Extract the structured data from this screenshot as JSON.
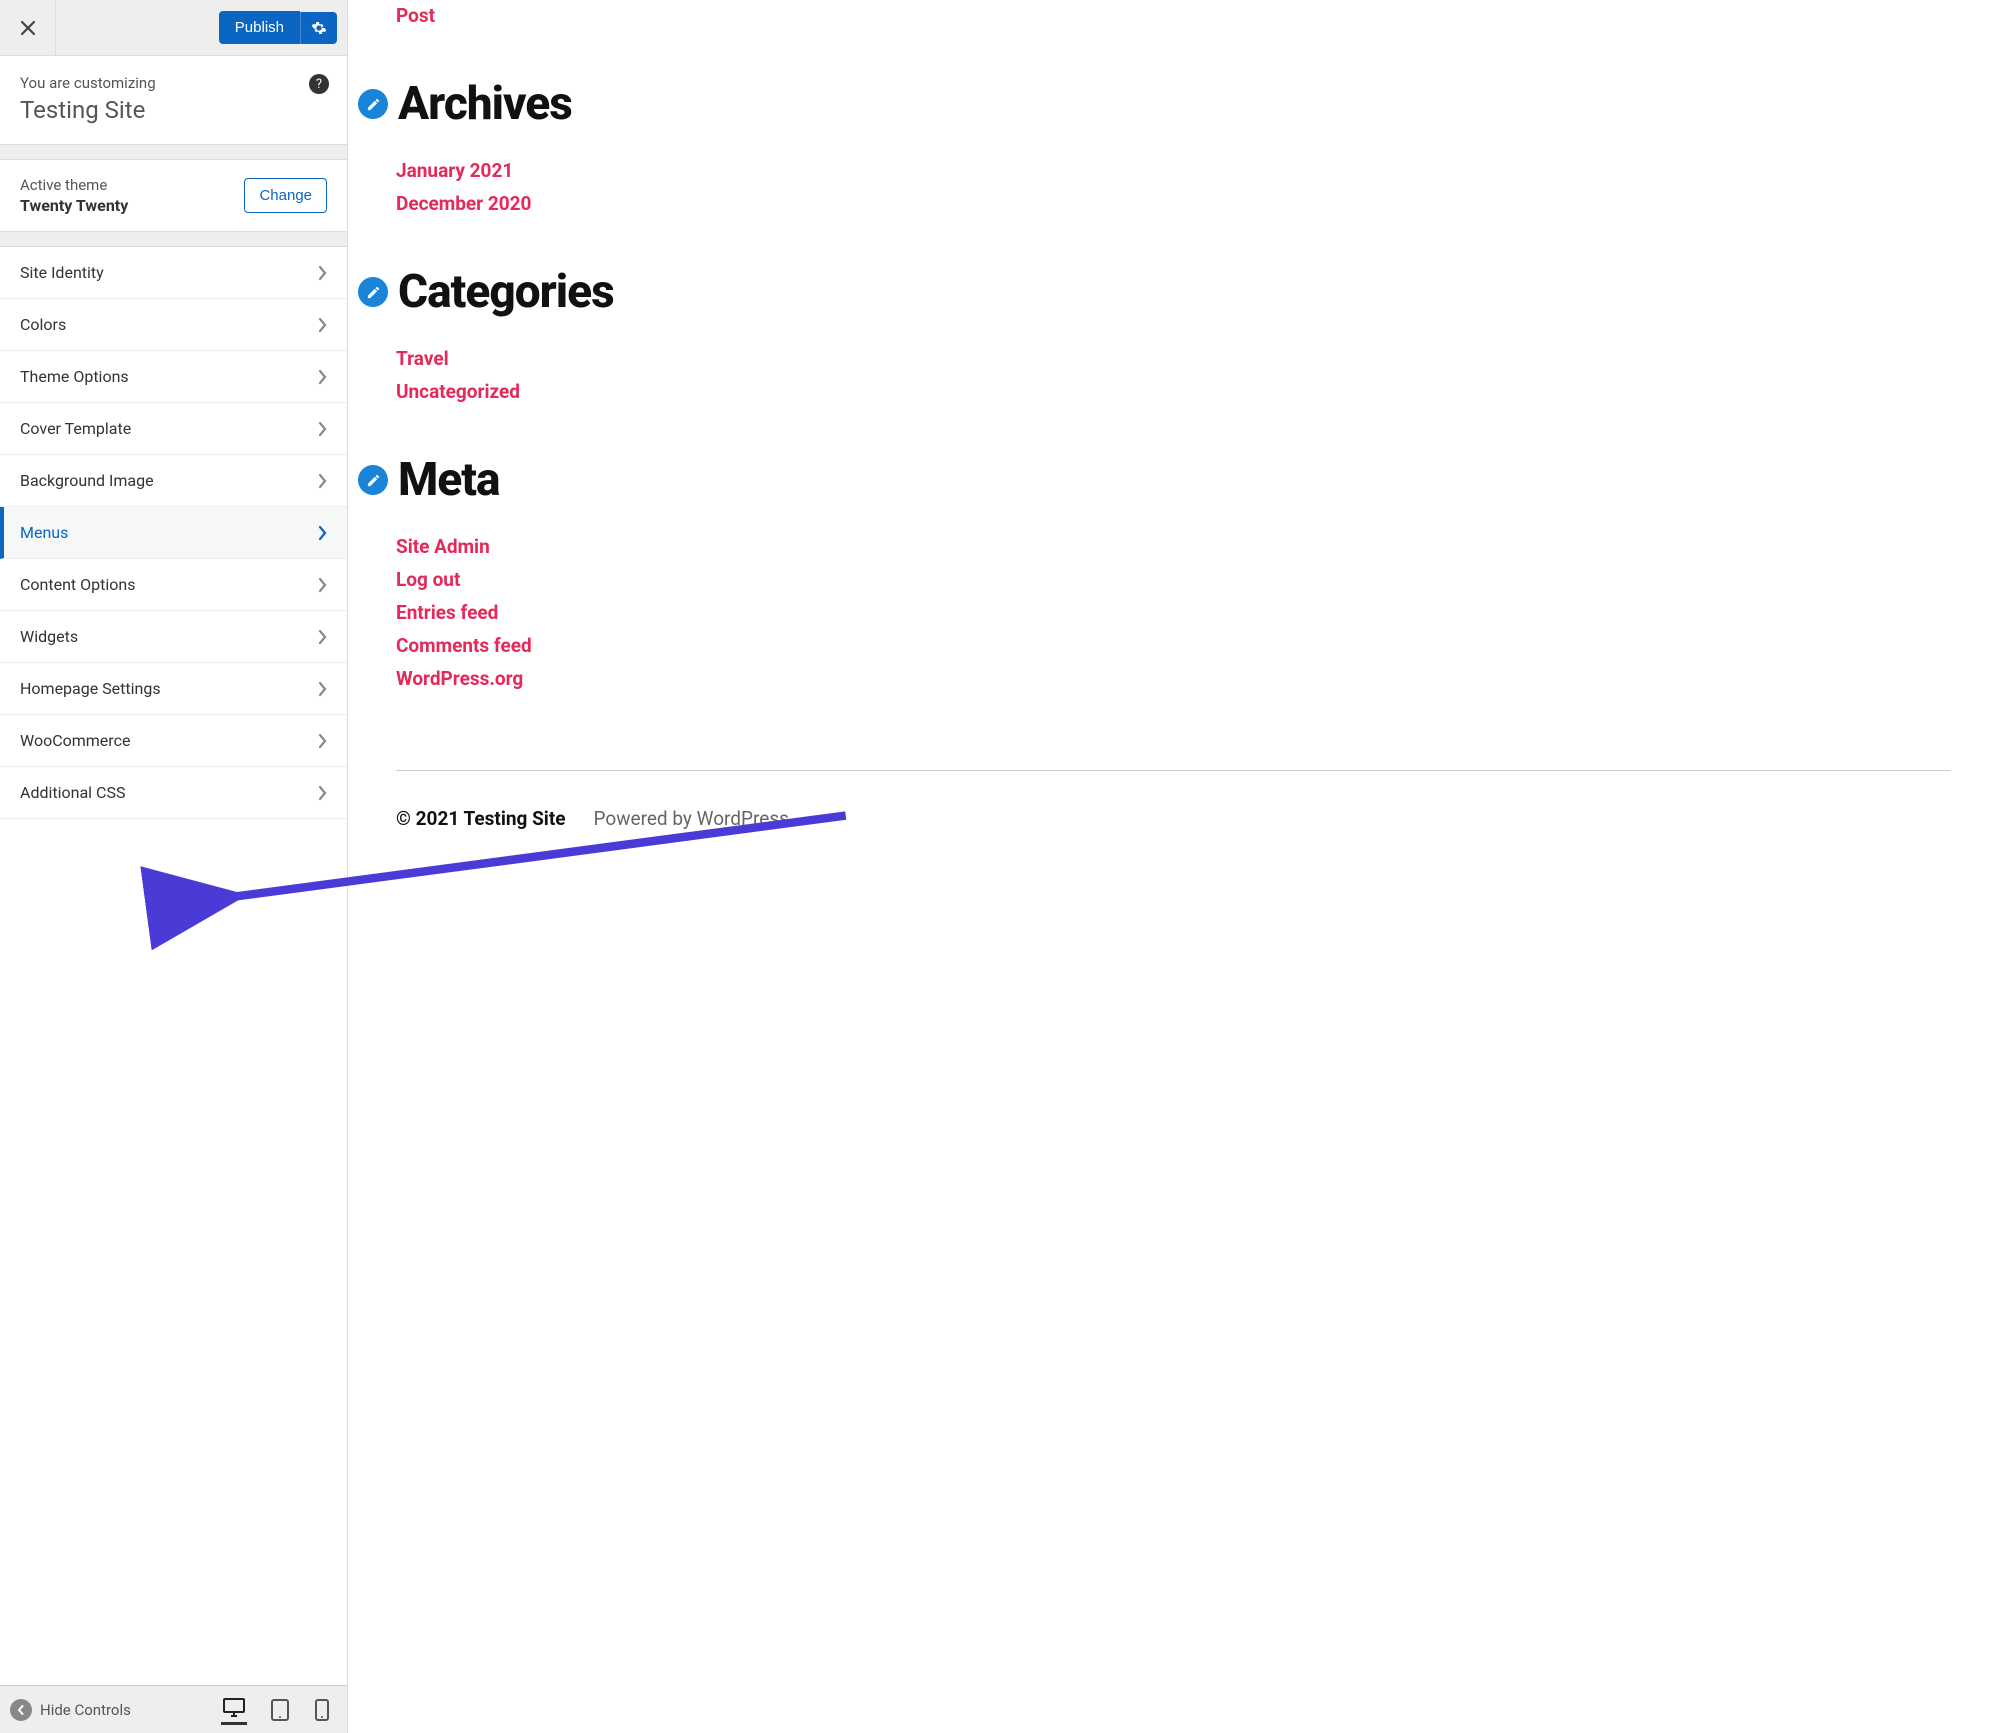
{
  "topbar": {
    "publish_label": "Publish"
  },
  "customize_panel": {
    "customizing_label": "You are customizing",
    "site_title": "Testing Site"
  },
  "theme_panel": {
    "active_label": "Active theme",
    "theme_name": "Twenty Twenty",
    "change_label": "Change"
  },
  "sidebar_menu": {
    "items": [
      {
        "label": "Site Identity",
        "active": false
      },
      {
        "label": "Colors",
        "active": false
      },
      {
        "label": "Theme Options",
        "active": false
      },
      {
        "label": "Cover Template",
        "active": false
      },
      {
        "label": "Background Image",
        "active": false
      },
      {
        "label": "Menus",
        "active": true
      },
      {
        "label": "Content Options",
        "active": false
      },
      {
        "label": "Widgets",
        "active": false
      },
      {
        "label": "Homepage Settings",
        "active": false
      },
      {
        "label": "WooCommerce",
        "active": false
      },
      {
        "label": "Additional CSS",
        "active": false
      }
    ]
  },
  "bottombar": {
    "hide_controls_label": "Hide Controls"
  },
  "preview": {
    "top_link": "Post",
    "widgets": [
      {
        "heading": "Archives",
        "links": [
          "January 2021",
          "December 2020"
        ]
      },
      {
        "heading": "Categories",
        "links": [
          "Travel",
          "Uncategorized"
        ]
      },
      {
        "heading": "Meta",
        "links": [
          "Site Admin",
          "Log out",
          "Entries feed",
          "Comments feed",
          "WordPress.org"
        ]
      }
    ],
    "footer": {
      "copyright": "© 2021 Testing Site",
      "powered": "Powered by WordPress"
    }
  }
}
